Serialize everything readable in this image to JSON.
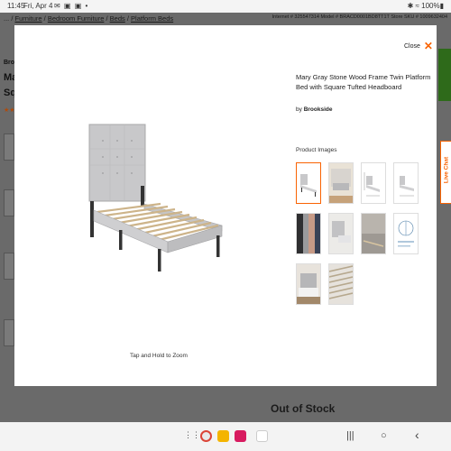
{
  "status_bar": {
    "time": "11:45",
    "date": "Fri, Apr 4",
    "icons_left": "✉ ▣ ▣ •",
    "icons_right": "✱ ≈ 100%▮"
  },
  "background_page": {
    "breadcrumbs": [
      "...",
      "Furniture",
      "Bedroom Furniture",
      "Beds",
      "Platform Beds"
    ],
    "breadcrumb_separator": "/",
    "meta": "Internet # 325547314   Model # BRACD0001BD8TT1T   Store SKU # 1009632404",
    "brand_fragment": "Brook",
    "title_fragment": "Ma Sq",
    "stars_fragment": "★★",
    "out_of_stock": "Out of Stock"
  },
  "live_chat": {
    "label": "Live Chat",
    "icon": "chat-icon"
  },
  "modal": {
    "close_label": "Close",
    "close_icon": "x-icon",
    "product_title": "Mary Gray Stone Wood Frame Twin Platform Bed with Square Tufted Headboard",
    "by_prefix": "by",
    "brand": "Brookside",
    "images_label": "Product Images",
    "zoom_hint": "Tap and Hold to Zoom",
    "thumbnails": [
      "bed-front-view",
      "bed-room-scene",
      "bed-dimensions",
      "bed-side-dimensions",
      "fabric-swatches",
      "headboard-detail",
      "assembly-steps",
      "support-diagram",
      "bed-bedroom-scene",
      "slat-detail"
    ]
  },
  "nav_bar": {
    "recents_icon": "|||",
    "home_icon": "○",
    "back_icon": "‹",
    "apps_icon": "⋮⋮"
  },
  "colors": {
    "accent": "#f96302",
    "overlay": "#6a6a6a",
    "modal_bg": "#ffffff",
    "bed_fabric": "#c9c9cb"
  }
}
